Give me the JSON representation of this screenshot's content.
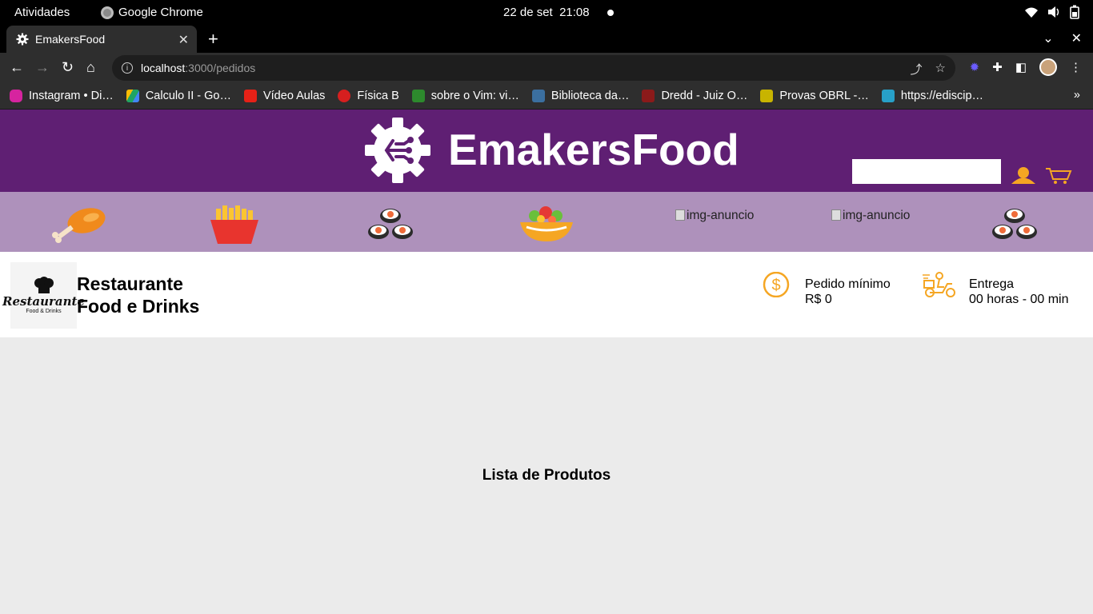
{
  "system": {
    "activities": "Atividades",
    "app_name": "Google Chrome",
    "date": "22 de set",
    "time": "21:08"
  },
  "browser": {
    "tab_title": "EmakersFood",
    "url_host": "localhost",
    "url_path": ":3000/pedidos",
    "bookmarks": [
      {
        "label": "Instagram • Di…",
        "color": "#d6249f"
      },
      {
        "label": "Calculo II - Go…",
        "color": "#1fa463"
      },
      {
        "label": "Vídeo Aulas",
        "color": "#e62117"
      },
      {
        "label": "Física B",
        "color": "#d61f1f"
      },
      {
        "label": "sobre o Vim: vi…",
        "color": "#2d8a2d"
      },
      {
        "label": "Biblioteca da…",
        "color": "#3b6fa0"
      },
      {
        "label": "Dredd - Juiz O…",
        "color": "#8b1a1a"
      },
      {
        "label": "Provas OBRL -…",
        "color": "#c8b400"
      },
      {
        "label": "https://ediscip…",
        "color": "#27a0c8"
      }
    ]
  },
  "header": {
    "brand": "EmakersFood",
    "search_placeholder": "",
    "accent": "#5f1f73",
    "icon_color": "#f5a623"
  },
  "categories": {
    "alt_text_1": "img-anuncio",
    "alt_text_2": "img-anuncio",
    "bar_color": "#ae91bb"
  },
  "restaurant": {
    "name_line1": "Restaurante",
    "name_line2": "Food e Drinks",
    "logo_text": "Restaurante",
    "logo_subtext": "Food & Drinks",
    "min_order_label": "Pedido mínimo",
    "min_order_value": "R$ 0",
    "delivery_label": "Entrega",
    "delivery_value": "00 horas - 00 min"
  },
  "main": {
    "list_title": "Lista de Produtos"
  }
}
